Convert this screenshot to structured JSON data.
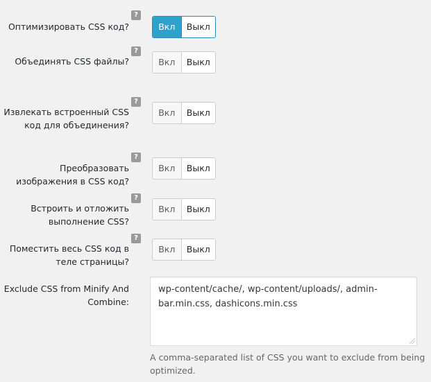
{
  "settings": [
    {
      "label": "Оптимизировать CSS код?",
      "on_label": "Вкл",
      "off_label": "Выкл",
      "value": "on"
    },
    {
      "label": "Объединять CSS файлы?",
      "on_label": "Вкл",
      "off_label": "Выкл",
      "value": "off"
    },
    {
      "label": "Извлекать встроенный CSS\nкод для объединения?",
      "on_label": "Вкл",
      "off_label": "Выкл",
      "value": "off"
    },
    {
      "label": "Преобразовать\nизображения в CSS код?",
      "on_label": "Вкл",
      "off_label": "Выкл",
      "value": "off"
    },
    {
      "label": "Встроить и отложить\nвыполнение CSS?",
      "on_label": "Вкл",
      "off_label": "Выкл",
      "value": "off"
    },
    {
      "label": "Поместить весь CSS код в\nтеле страницы?",
      "on_label": "Вкл",
      "off_label": "Выкл",
      "value": "off"
    }
  ],
  "help_icon": "?",
  "exclude": {
    "label": "Exclude CSS from Minify And\nCombine:",
    "value": "wp-content/cache/, wp-content/uploads/, admin-bar.min.css, dashicons.min.css",
    "description": "A comma-separated list of CSS you want to exclude from being optimized."
  },
  "colors": {
    "active_toggle": "#2ea2cc",
    "background": "#f1f1f1"
  }
}
